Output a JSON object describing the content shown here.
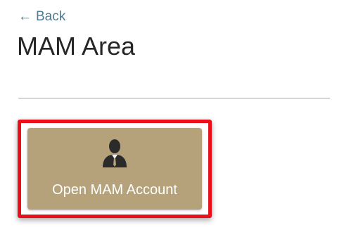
{
  "nav": {
    "back_arrow": "←",
    "back_label": "Back"
  },
  "header": {
    "title": "MAM Area"
  },
  "actions": {
    "open_mam_account": {
      "label": "Open MAM Account",
      "icon": "user-tie-icon"
    }
  },
  "colors": {
    "link": "#4d7d94",
    "title": "#262626",
    "divider": "#b8a67c",
    "card_background": "#b5a27b",
    "card_text": "#ffffff",
    "highlight_border": "#e8101a",
    "icon": "#2b2b2b"
  }
}
